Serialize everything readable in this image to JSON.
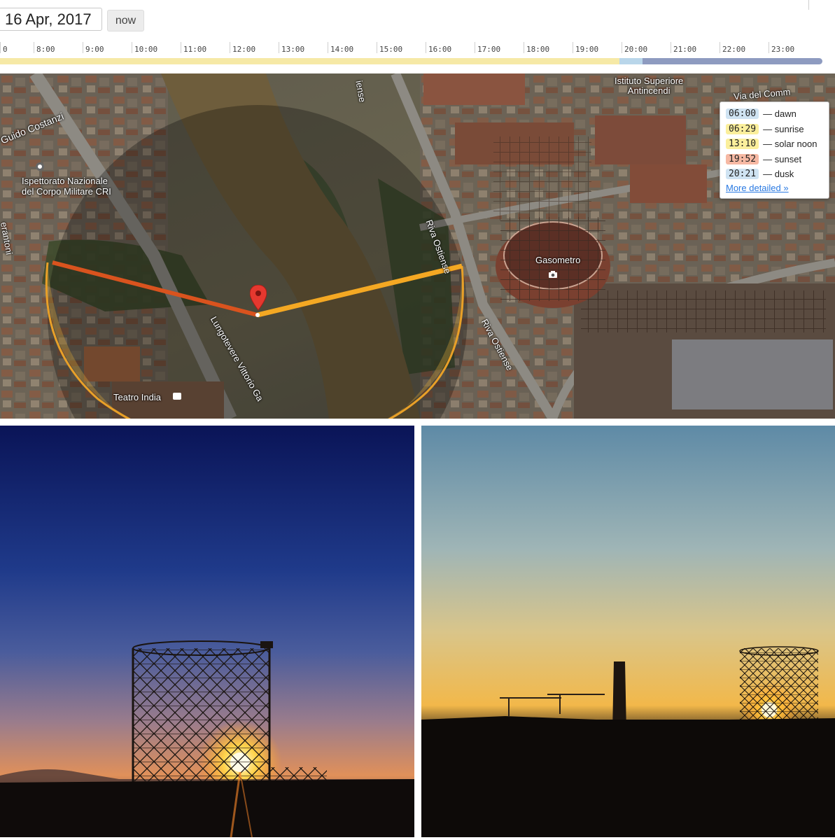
{
  "date": {
    "value": "16 Apr, 2017"
  },
  "now_button": {
    "label": "now"
  },
  "timeline": {
    "hours": [
      "0",
      "8:00",
      "9:00",
      "10:00",
      "11:00",
      "12:00",
      "13:00",
      "14:00",
      "15:00",
      "16:00",
      "17:00",
      "18:00",
      "19:00",
      "20:00",
      "21:00",
      "22:00",
      "23:00"
    ],
    "colors": {
      "day": "#f6e9a6",
      "twilight": "#b9d6ea",
      "night": "#8e9bc0"
    }
  },
  "map": {
    "labels": {
      "istituto": "Istituto Superiore\nAntincendi",
      "via": "Via del Comm",
      "guido": "Guido Costanzi",
      "ispettorato": "Ispettorato Nazionale\ndel Corpo Militare CRI",
      "gasometro": "Gasometro",
      "riva1": "Riva Ostiense",
      "riva2": "Riva Ostiense",
      "lungotevere": "Lungotevere Vittorio Ga",
      "teatro": "Teatro India",
      "ostiense_top": "iense",
      "rantoni": "erantoni"
    },
    "pin_icon": "map-pin-icon",
    "camera_icon": "camera-icon"
  },
  "legend": {
    "rows": [
      {
        "time": "06:00",
        "label": "dawn",
        "color": "#cfe3f2"
      },
      {
        "time": "06:29",
        "label": "sunrise",
        "color": "#fbef9c"
      },
      {
        "time": "13:10",
        "label": "solar noon",
        "color": "#fbef9c"
      },
      {
        "time": "19:52",
        "label": "sunset",
        "color": "#f6b9a4"
      },
      {
        "time": "20:21",
        "label": "dusk",
        "color": "#cfe3f2"
      }
    ],
    "more_link": "More detailed »"
  }
}
